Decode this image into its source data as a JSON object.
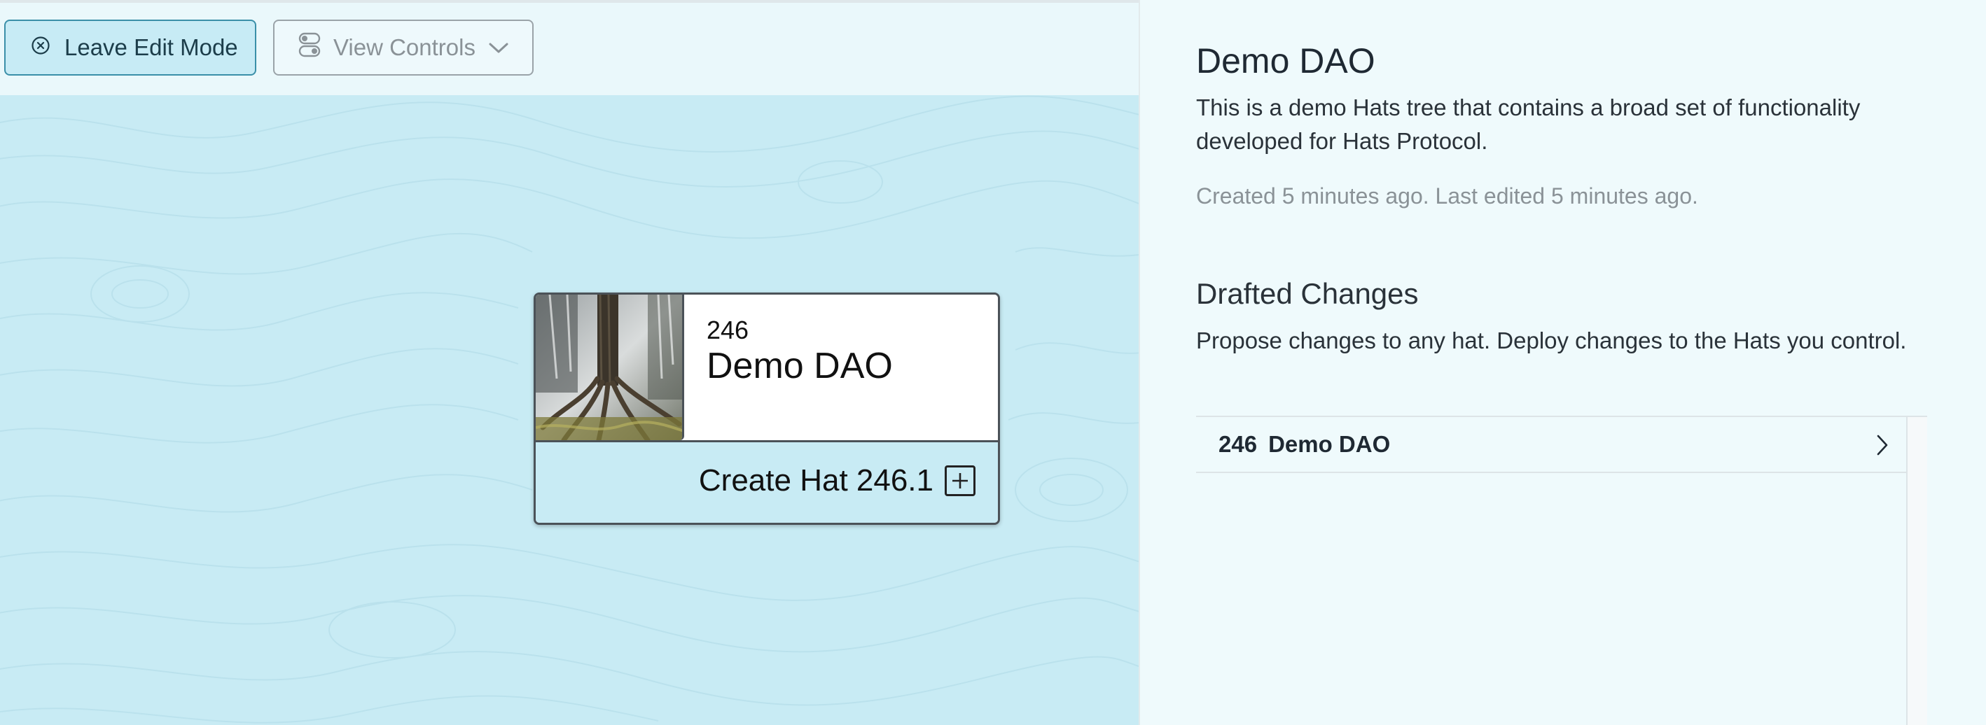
{
  "toolbar": {
    "leave_edit_label": "Leave Edit Mode",
    "view_controls_label": "View Controls"
  },
  "hat_card": {
    "id": "246",
    "name": "Demo DAO",
    "create_label": "Create Hat 246.1"
  },
  "panel": {
    "title": "Demo DAO",
    "description": "This is a demo Hats tree that contains a broad set of functionality developed for Hats Protocol.",
    "meta": "Created 5 minutes ago. Last edited 5 minutes ago.",
    "drafted_heading": "Drafted Changes",
    "drafted_subtitle": "Propose changes to any hat. Deploy changes to the Hats you control.",
    "drafts": [
      {
        "id": "246",
        "name": "Demo DAO"
      }
    ]
  },
  "icons": {
    "leave": "close-circle-icon",
    "view": "toggle-icon",
    "view_chevron": "chevron-down-icon",
    "plus": "plus-icon",
    "row_chevron": "chevron-right-icon"
  },
  "colors": {
    "canvas": "#c8ebf4",
    "panel": "#effafc",
    "accent_border": "#3a8fa8"
  }
}
